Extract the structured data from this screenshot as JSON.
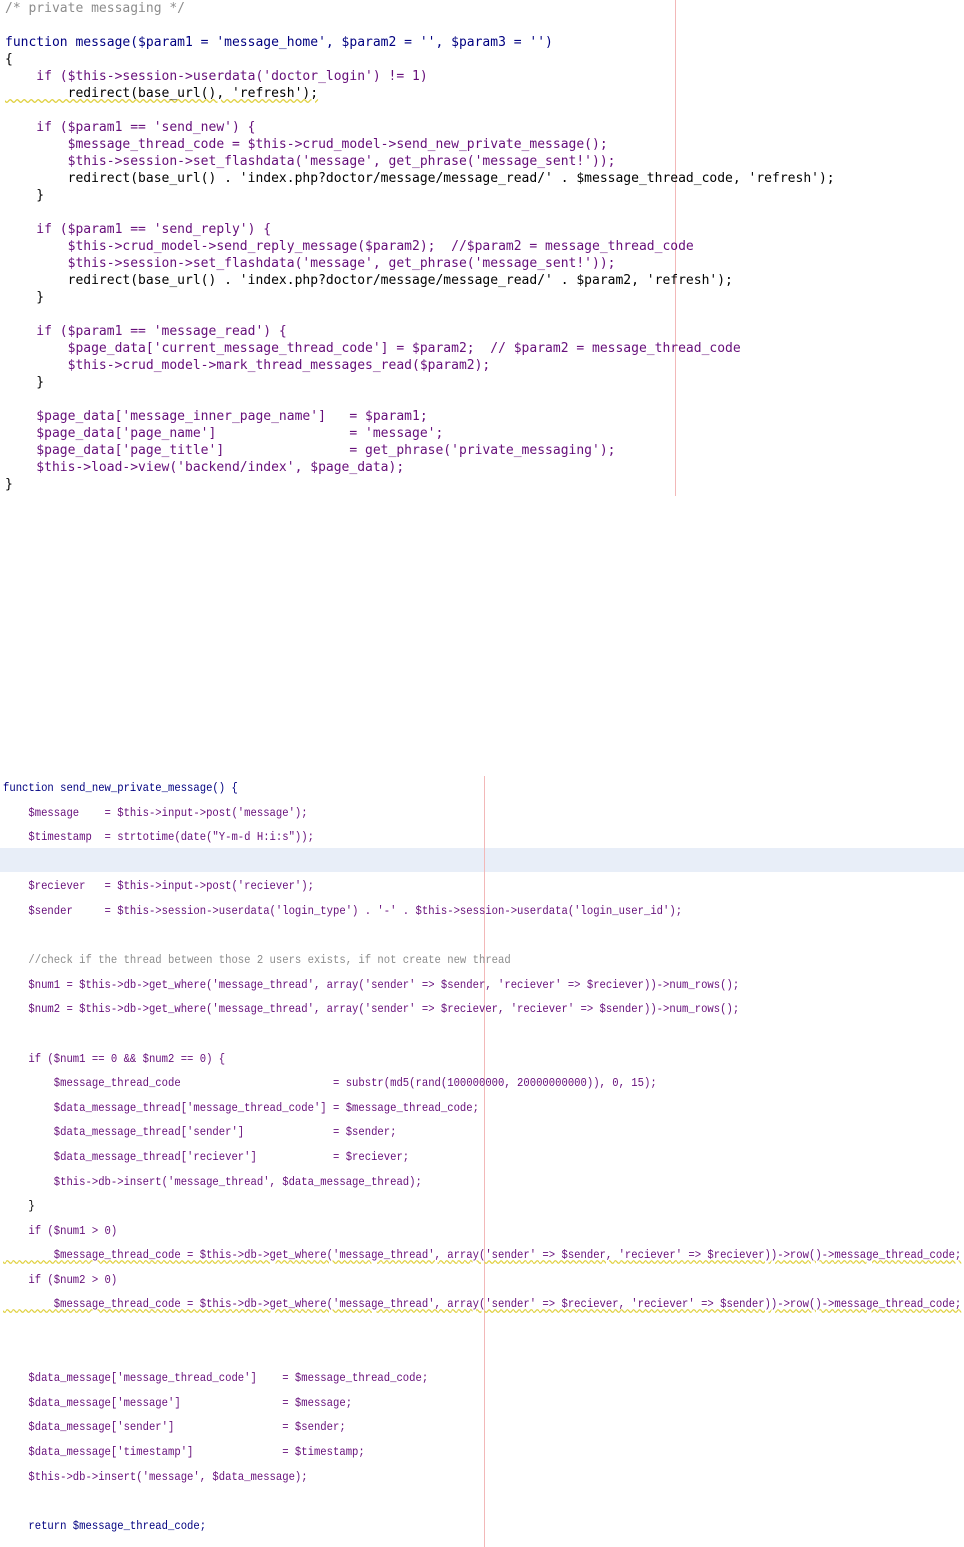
{
  "top_panel": {
    "lines": [
      "/* private messaging */",
      "",
      "function message($param1 = 'message_home', $param2 = '', $param3 = '')",
      "{",
      "    if ($this->session->userdata('doctor_login') != 1)",
      "        redirect(base_url(), 'refresh');",
      "",
      "    if ($param1 == 'send_new') {",
      "        $message_thread_code = $this->crud_model->send_new_private_message();",
      "        $this->session->set_flashdata('message', get_phrase('message_sent!'));",
      "        redirect(base_url() . 'index.php?doctor/message/message_read/' . $message_thread_code, 'refresh');",
      "    }",
      "",
      "    if ($param1 == 'send_reply') {",
      "        $this->crud_model->send_reply_message($param2);  //$param2 = message_thread_code",
      "        $this->session->set_flashdata('message', get_phrase('message_sent!'));",
      "        redirect(base_url() . 'index.php?doctor/message/message_read/' . $param2, 'refresh');",
      "    }",
      "",
      "    if ($param1 == 'message_read') {",
      "        $page_data['current_message_thread_code'] = $param2;  // $param2 = message_thread_code",
      "        $this->crud_model->mark_thread_messages_read($param2);",
      "    }",
      "",
      "    $page_data['message_inner_page_name']   = $param1;",
      "    $page_data['page_name']                 = 'message';",
      "    $page_data['page_title']                = get_phrase('private_messaging');",
      "    $this->load->view('backend/index', $page_data);",
      "}"
    ]
  },
  "bottom_panel": {
    "lines": [
      "function send_new_private_message() {",
      "    $message    = $this->input->post('message');",
      "    $timestamp  = strtotime(date(\"Y-m-d H:i:s\"));",
      "",
      "    $reciever   = $this->input->post('reciever');",
      "    $sender     = $this->session->userdata('login_type') . '-' . $this->session->userdata('login_user_id');",
      "",
      "    //check if the thread between those 2 users exists, if not create new thread",
      "    $num1 = $this->db->get_where('message_thread', array('sender' => $sender, 'reciever' => $reciever))->num_rows();",
      "    $num2 = $this->db->get_where('message_thread', array('sender' => $reciever, 'reciever' => $sender))->num_rows();",
      "",
      "    if ($num1 == 0 && $num2 == 0) {",
      "        $message_thread_code                        = substr(md5(rand(100000000, 20000000000)), 0, 15);",
      "        $data_message_thread['message_thread_code'] = $message_thread_code;",
      "        $data_message_thread['sender']              = $sender;",
      "        $data_message_thread['reciever']            = $reciever;",
      "        $this->db->insert('message_thread', $data_message_thread);",
      "    }",
      "    if ($num1 > 0)",
      "        $message_thread_code = $this->db->get_where('message_thread', array('sender' => $sender, 'reciever' => $reciever))->row()->message_thread_code;",
      "    if ($num2 > 0)",
      "        $message_thread_code = $this->db->get_where('message_thread', array('sender' => $reciever, 'reciever' => $sender))->row()->message_thread_code;",
      "",
      "",
      "    $data_message['message_thread_code']    = $message_thread_code;",
      "    $data_message['message']                = $message;",
      "    $data_message['sender']                 = $sender;",
      "    $data_message['timestamp']              = $timestamp;",
      "    $this->db->insert('message', $data_message);",
      "",
      "    return $message_thread_code;"
    ]
  }
}
